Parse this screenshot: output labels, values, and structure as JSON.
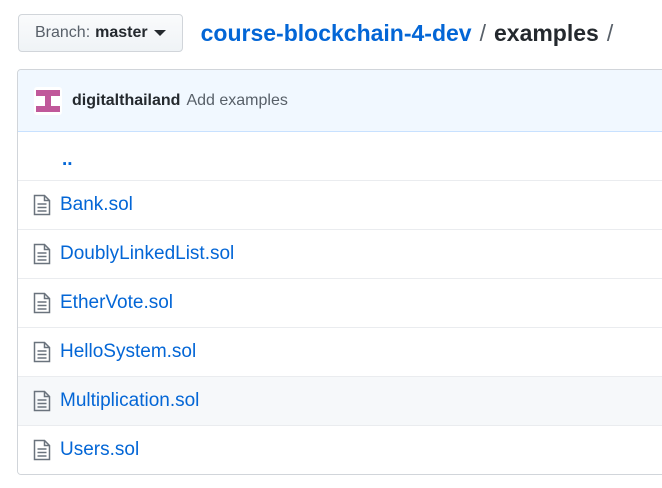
{
  "branch": {
    "prefix": "Branch:",
    "name": "master"
  },
  "breadcrumb": {
    "repo": "course-blockchain-4-dev",
    "separator": "/",
    "current": "examples",
    "trailing_separator": "/"
  },
  "commit": {
    "author": "digitalthailand",
    "message": "Add examples"
  },
  "files": {
    "parent_link": "..",
    "items": [
      {
        "name": "Bank.sol",
        "icon": "file-icon"
      },
      {
        "name": "DoublyLinkedList.sol",
        "icon": "file-icon"
      },
      {
        "name": "EtherVote.sol",
        "icon": "file-icon"
      },
      {
        "name": "HelloSystem.sol",
        "icon": "file-icon"
      },
      {
        "name": "Multiplication.sol",
        "icon": "file-icon"
      },
      {
        "name": "Users.sol",
        "icon": "file-icon"
      }
    ]
  },
  "colors": {
    "link": "#0366d6",
    "commit_bar_bg": "#f1f8ff",
    "avatar_accent": "#c0589a",
    "row_hover_bg": "#f6f8fa"
  }
}
